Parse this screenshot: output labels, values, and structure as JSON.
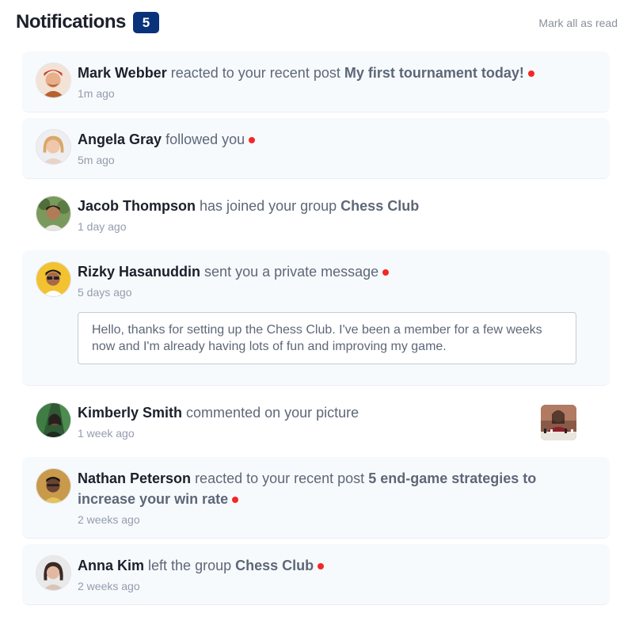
{
  "header": {
    "title": "Notifications",
    "badge_count": "5",
    "mark_all_label": "Mark all as read"
  },
  "colors": {
    "unread_dot": "#f62626",
    "badge_bg": "#0a327b",
    "unread_bg": "#f7fafd"
  },
  "notifications": [
    {
      "name": "Mark Webber",
      "action": "reacted to your recent post",
      "target": "My first tournament today!",
      "time": "1m ago",
      "unread": true
    },
    {
      "name": "Angela Gray",
      "action": "followed you",
      "target": "",
      "time": "5m ago",
      "unread": true
    },
    {
      "name": "Jacob Thompson",
      "action": "has joined your group",
      "target": "Chess Club",
      "time": "1 day ago",
      "unread": false
    },
    {
      "name": "Rizky Hasanuddin",
      "action": "sent you a private message",
      "target": "",
      "time": "5 days ago",
      "unread": true,
      "message": "Hello, thanks for setting up the Chess Club. I've been a member for a few weeks now and I'm already having lots of fun and improving my game."
    },
    {
      "name": "Kimberly Smith",
      "action": "commented on your picture",
      "target": "",
      "time": "1 week ago",
      "unread": false,
      "picture_icon": "chess-picture-thumbnail"
    },
    {
      "name": "Nathan Peterson",
      "action": "reacted to your recent post",
      "target": "5 end-game strategies to increase your win rate",
      "time": "2 weeks ago",
      "unread": true
    },
    {
      "name": "Anna Kim",
      "action": "left the group",
      "target": "Chess Club",
      "time": "2 weeks ago",
      "unread": true
    }
  ]
}
